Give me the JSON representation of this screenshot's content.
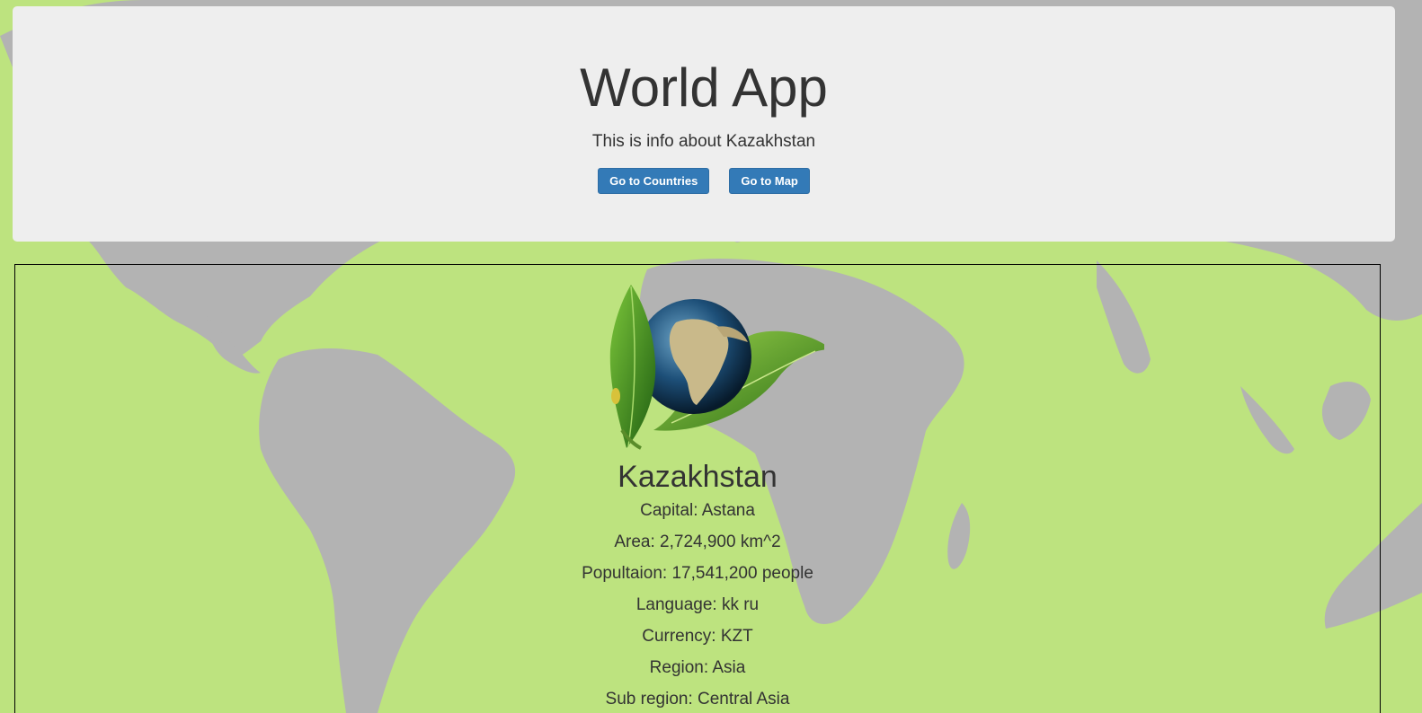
{
  "header": {
    "title": "World App",
    "subtitle": "This is info about Kazakhstan",
    "buttons": {
      "countries": "Go to Countries",
      "map": "Go to Map"
    }
  },
  "country": {
    "name": "Kazakhstan",
    "capital": "Capital: Astana",
    "area": "Area: 2,724,900 km^2",
    "population": "Popultaion: 17,541,200 people",
    "language": "Language: kk ru",
    "currency": "Currency: KZT",
    "region": "Region: Asia",
    "subregion": "Sub region: Central Asia"
  },
  "images": {
    "logo": "globe-with-leaves",
    "background": "world-map"
  },
  "colors": {
    "background": "#bde37f",
    "land": "#b3b3b3",
    "jumbotron": "#eeeeee",
    "button": "#337ab7",
    "text": "#333333"
  }
}
